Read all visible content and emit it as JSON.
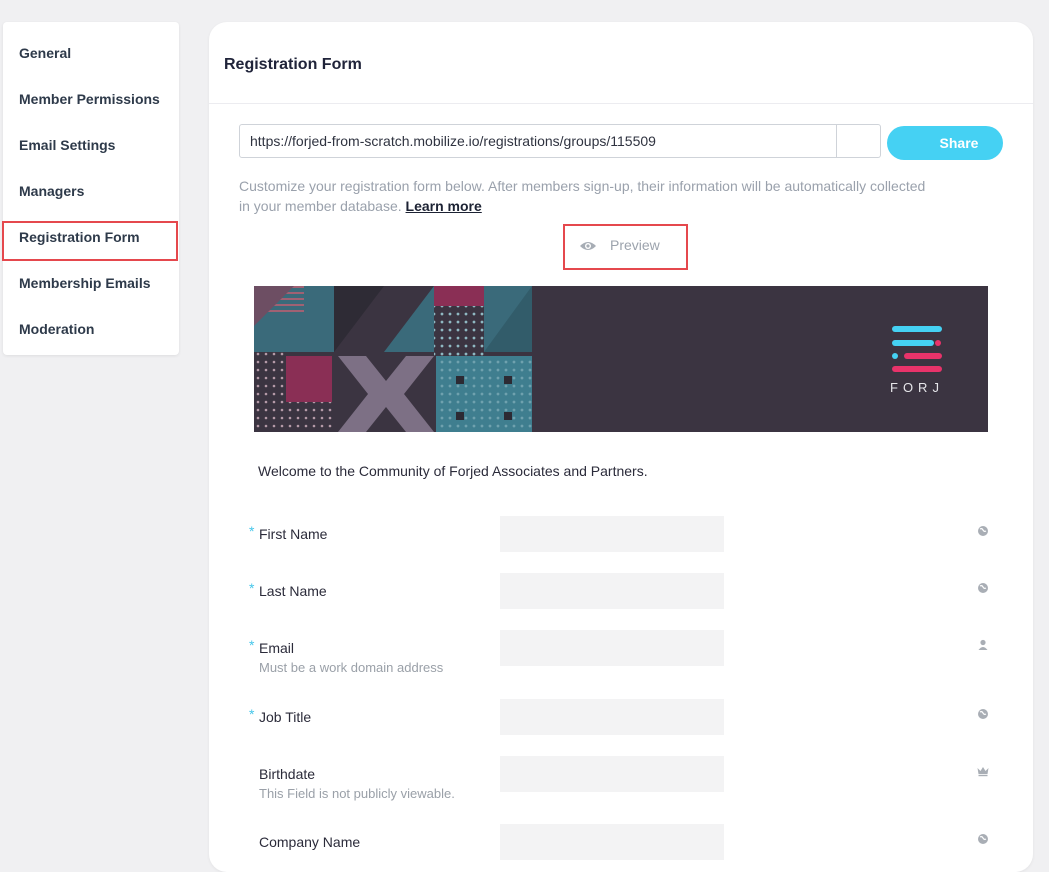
{
  "sidebar": {
    "items": [
      {
        "label": "General"
      },
      {
        "label": "Member Permissions"
      },
      {
        "label": "Email Settings"
      },
      {
        "label": "Managers"
      },
      {
        "label": "Registration Form",
        "active": true
      },
      {
        "label": "Membership Emails"
      },
      {
        "label": "Moderation"
      }
    ]
  },
  "card": {
    "title": "Registration Form",
    "url_value": "https://forjed-from-scratch.mobilize.io/registrations/groups/115509",
    "share_label": "Share",
    "help_text": "Customize your registration form below. After members sign-up, their information will be automatically collected in your member database.",
    "learn_more": "Learn more",
    "preview_label": "Preview",
    "preview_icon": "eye-icon"
  },
  "banner": {
    "logo_text": "FORJ",
    "colors": {
      "background": "#3b3441",
      "cyan": "#45d1f3",
      "pink": "#e8336a"
    }
  },
  "form": {
    "welcome": "Welcome to the Community of Forjed Associates and Partners.",
    "fields": [
      {
        "label": "First Name",
        "required": true,
        "sub": "",
        "visibility": "globe-icon"
      },
      {
        "label": "Last Name",
        "required": true,
        "sub": "",
        "visibility": "globe-icon"
      },
      {
        "label": "Email",
        "required": true,
        "sub": "Must be a work domain address",
        "visibility": "user-icon"
      },
      {
        "label": "Job Title",
        "required": true,
        "sub": "",
        "visibility": "globe-icon"
      },
      {
        "label": "Birthdate",
        "required": false,
        "sub": "This Field is not publicly viewable.",
        "visibility": "crown-icon"
      },
      {
        "label": "Company Name",
        "required": false,
        "sub": "",
        "visibility": "globe-icon"
      }
    ],
    "required_mark": "*"
  },
  "colors": {
    "accent": "#45d1f3",
    "highlight": "#e5484d"
  }
}
